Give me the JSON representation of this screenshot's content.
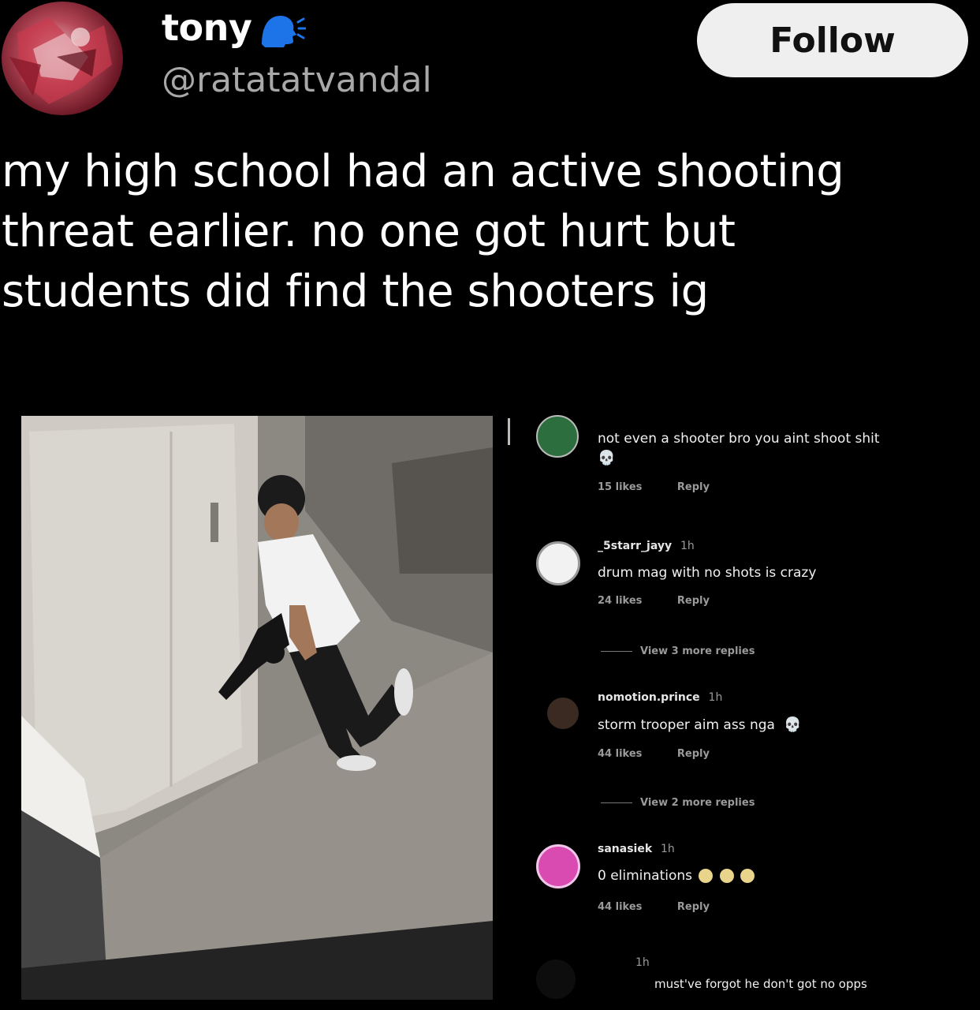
{
  "header": {
    "display_name": "tony",
    "name_icon": "speaking-head-icon",
    "handle": "@ratatatvandal",
    "follow_label": "Follow"
  },
  "tweet": {
    "lines": [
      "my high school had an active shooting",
      "threat earlier. no one got hurt but",
      "students did find the shooters ig"
    ]
  },
  "comments": [
    {
      "username": "",
      "time": "",
      "text": "not even a shooter bro you aint shoot shit",
      "emoji": "skull-icon",
      "likes": "15 likes",
      "reply": "Reply"
    },
    {
      "username": "_5starr_jayy",
      "time": "1h",
      "text": "drum mag with no shots is crazy",
      "likes": "24 likes",
      "reply": "Reply",
      "more_replies": "View 3 more replies"
    },
    {
      "username": "nomotion.prince",
      "time": "1h",
      "text": "storm trooper aim ass nga",
      "emoji": "skull-icon",
      "likes": "44 likes",
      "reply": "Reply",
      "more_replies": "View 2 more replies"
    },
    {
      "username": "sanasiek",
      "time": "1h",
      "text": "0 eliminations",
      "emoji": "grimacing-face-icon",
      "likes": "44 likes",
      "reply": "Reply"
    },
    {
      "username": "",
      "time": "1h",
      "text": "must've forgot he don't got no opps"
    }
  ],
  "colors": {
    "background": "#000000",
    "handle": "#a8a8a8",
    "follow_bg": "#efefef",
    "verified_blue": "#1d74e8"
  }
}
